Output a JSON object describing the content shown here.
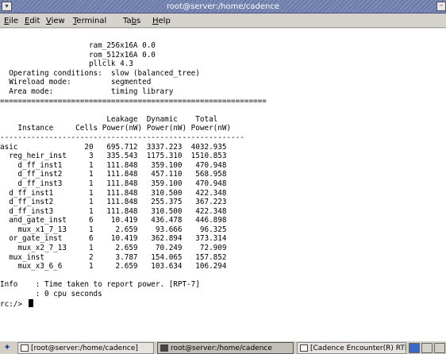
{
  "window": {
    "title": "root@server:/home/cadence",
    "system_glyph": "▾",
    "minimize_glyph": "–"
  },
  "menu": [
    {
      "key": "E",
      "rest": "ile",
      "label": "File"
    },
    {
      "key": "E",
      "rest": "dit",
      "label": "Edit"
    },
    {
      "key": "V",
      "rest": "iew",
      "label": "View"
    },
    {
      "key": "T",
      "rest": "erminal",
      "label": "Terminal"
    },
    {
      "key": "b",
      "pre": "Ta",
      "rest": "s",
      "label": "Tabs"
    },
    {
      "key": "H",
      "rest": "elp",
      "label": "Help"
    }
  ],
  "terminal": {
    "lines": [
      "                    ram_256x16A 0.0",
      "                    rom_512x16A 0.0",
      "                    pllclk 4.3",
      "  Operating conditions:  slow (balanced_tree)",
      "  Wireload mode:         segmented",
      "  Area mode:             timing library",
      "============================================================",
      "",
      "                        Leakage  Dynamic    Total",
      "    Instance     Cells Power(nW) Power(nW) Power(nW)",
      "-------------------------------------------------------",
      "asic               20   695.712  3337.223  4032.935",
      "  reg_heir_inst     3   335.543  1175.310  1510.853",
      "    d_ff_inst1      1   111.848   359.100   470.948",
      "    d_ff_inst2      1   111.848   457.110   568.958",
      "    d_ff_inst3      1   111.848   359.100   470.948",
      "  d_ff_inst1        1   111.848   310.500   422.348",
      "  d_ff_inst2        1   111.848   255.375   367.223",
      "  d_ff_inst3        1   111.848   310.500   422.348",
      "  and_gate_inst     6    10.419   436.478   446.898",
      "    mux_x1_7_13     1     2.659    93.666    96.325",
      "  or_gate_inst      6    10.419   362.894   373.314",
      "    mux_x2_7_13     1     2.659    70.249    72.909",
      "  mux_inst          2     3.787   154.065   157.852",
      "    mux_x3_6_6      1     2.659   103.634   106.294",
      "",
      "Info    : Time taken to report power. [RPT-7]",
      "        : 0 cpu seconds"
    ],
    "prompt": "rc:/> "
  },
  "taskbar": {
    "tasks": [
      {
        "label": "[root@server:/home/cadence]",
        "active": false
      },
      {
        "label": "root@server:/home/cadence",
        "active": true
      },
      {
        "label": "[Cadence Encounter(R) RTL Co",
        "active": false
      }
    ]
  },
  "colors": {
    "titlebar": "#7e8cb8",
    "pager_active": "#3b67c7",
    "pager_inactive": "#d4d0c8"
  }
}
